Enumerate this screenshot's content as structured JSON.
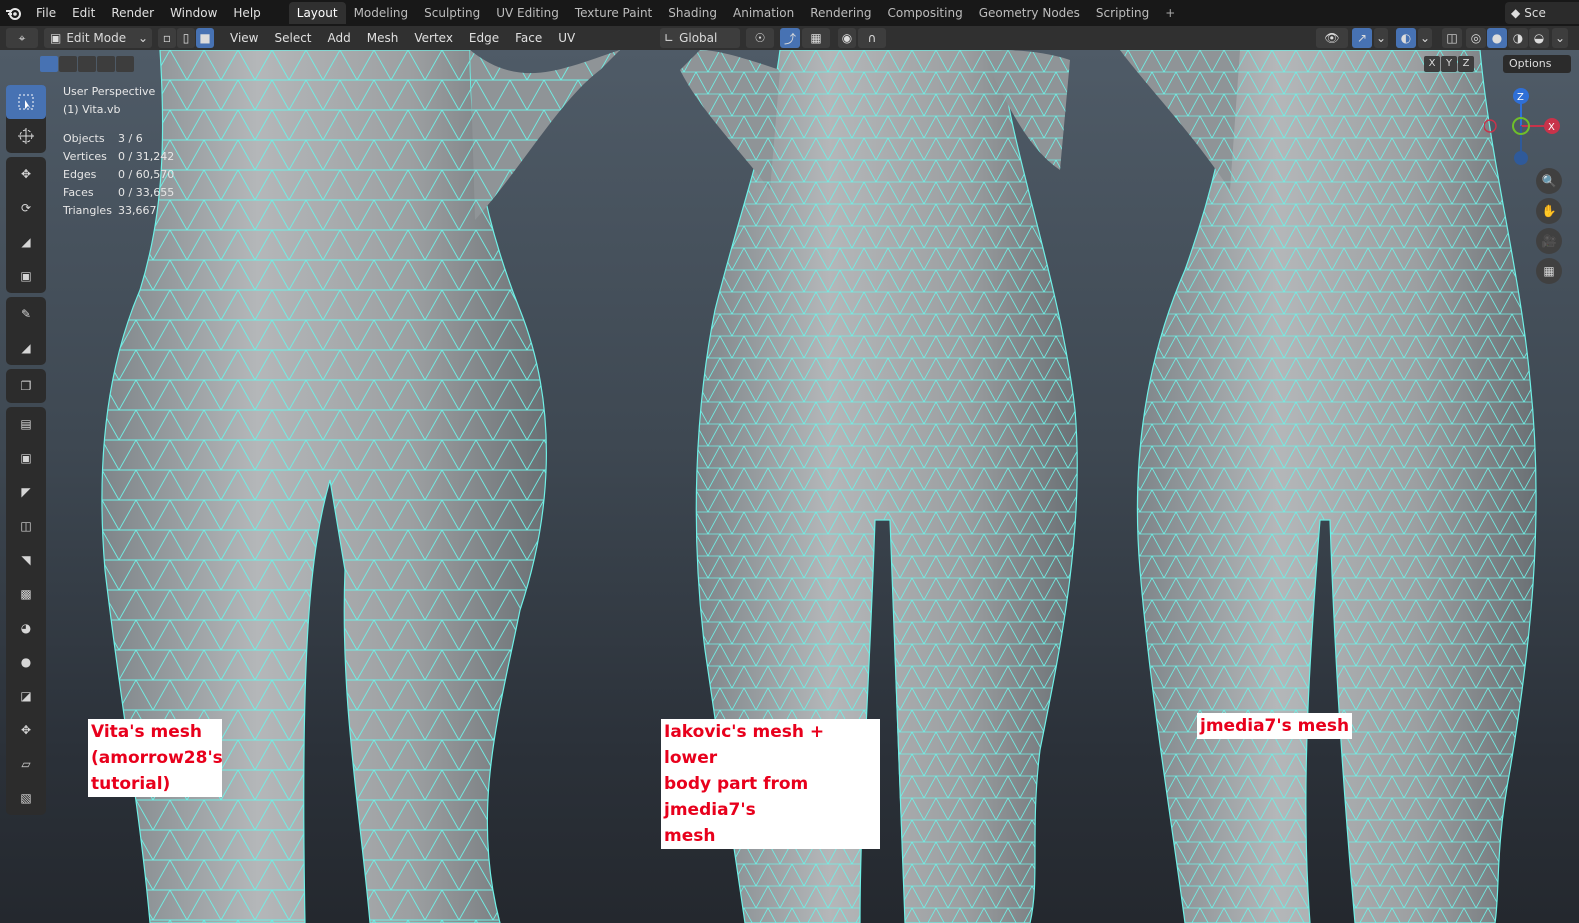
{
  "menu": {
    "items": [
      "File",
      "Edit",
      "Render",
      "Window",
      "Help"
    ]
  },
  "workspaces": {
    "tabs": [
      "Layout",
      "Modeling",
      "Sculpting",
      "UV Editing",
      "Texture Paint",
      "Shading",
      "Animation",
      "Rendering",
      "Compositing",
      "Geometry Nodes",
      "Scripting"
    ],
    "active": "Layout"
  },
  "scene": {
    "label": "Sce"
  },
  "header": {
    "mode": "Edit Mode",
    "menus": [
      "View",
      "Select",
      "Add",
      "Mesh",
      "Vertex",
      "Edge",
      "Face",
      "UV"
    ],
    "orientation": "Global"
  },
  "viewport": {
    "perspective": "User Perspective",
    "object": "(1) Vita.vb",
    "stats": [
      {
        "key": "Objects",
        "value": "3 / 6"
      },
      {
        "key": "Vertices",
        "value": "0 / 31,242"
      },
      {
        "key": "Edges",
        "value": "0 / 60,570"
      },
      {
        "key": "Faces",
        "value": "0 / 33,655"
      },
      {
        "key": "Triangles",
        "value": "33,667"
      }
    ],
    "axis_buttons": [
      "X",
      "Y",
      "Z"
    ],
    "options_label": "Options",
    "gizmo": {
      "z": "Z",
      "x": "X"
    }
  },
  "annotations": [
    {
      "lines": [
        "Vita's mesh",
        "(amorrow28's",
        "tutorial)"
      ]
    },
    {
      "lines": [
        "Iakovic's mesh + lower",
        "body part from jmedia7's",
        "mesh"
      ]
    },
    {
      "lines": [
        "jmedia7's mesh"
      ]
    }
  ],
  "colors": {
    "wire": "#6ff0e6",
    "active_tool": "#4772b3",
    "label_text": "#e8001c"
  }
}
